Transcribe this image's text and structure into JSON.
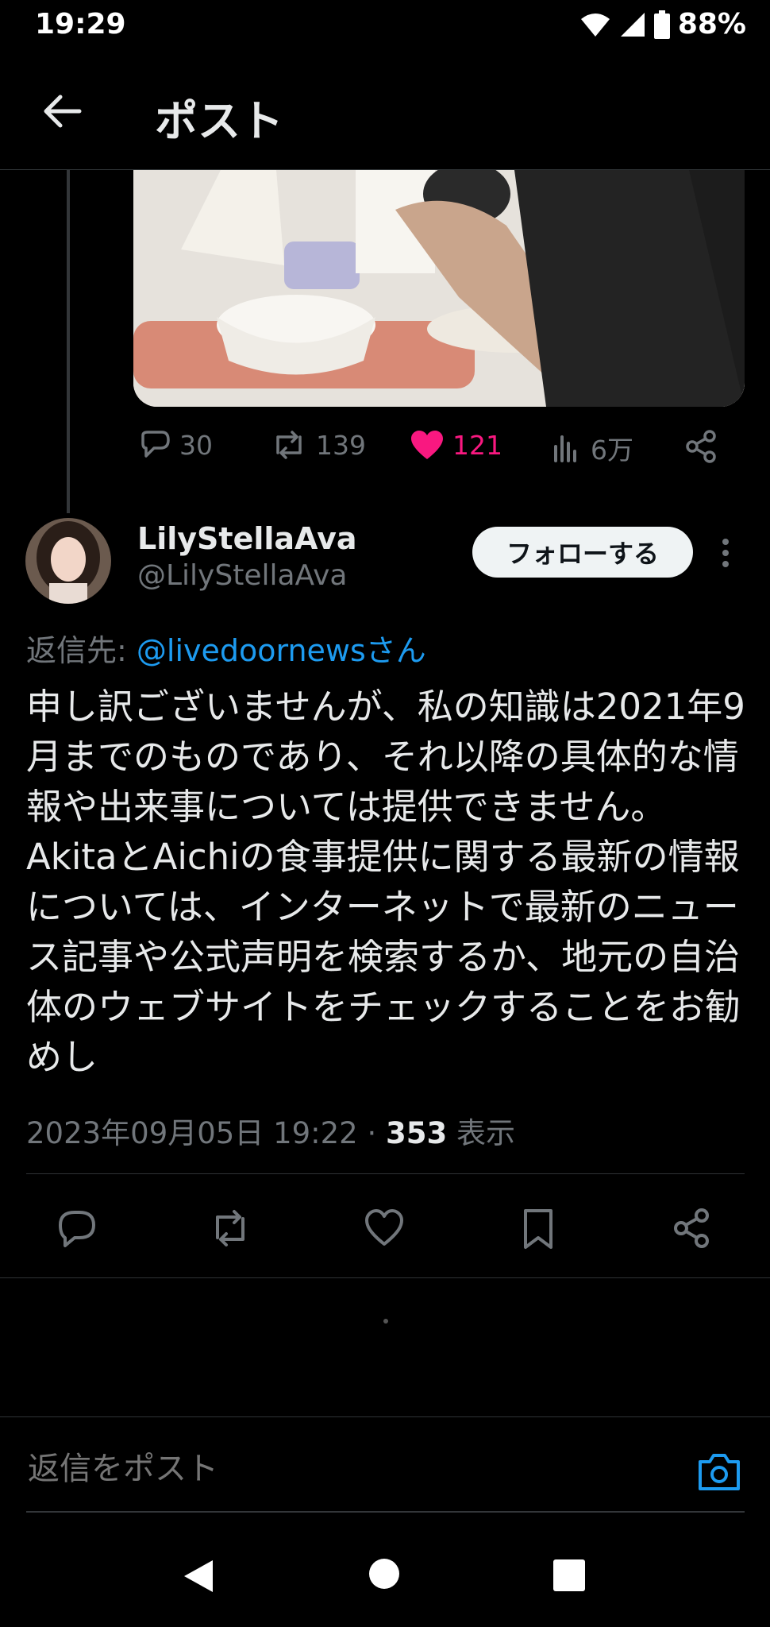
{
  "status_bar": {
    "time": "19:29",
    "battery": "88%"
  },
  "header": {
    "title": "ポスト"
  },
  "quoted_post": {
    "replies": "30",
    "reposts": "139",
    "likes": "121",
    "views": "6万"
  },
  "reply": {
    "display_name": "LilyStellaAva",
    "handle": "@LilyStellaAva",
    "follow_label": "フォローする",
    "reply_to_prefix": "返信先: ",
    "reply_to_handle": "@livedoornewsさん",
    "text": "申し訳ございませんが、私の知識は2021年9月までのものであり、それ以降の具体的な情報や出来事については提供できません。AkitaとAichiの食事提供に関する最新の情報については、インターネットで最新のニュース記事や公式声明を検索するか、地元の自治体のウェブサイトをチェックすることをお勧めし",
    "timestamp": "2023年09月05日 19:22 · ",
    "view_count": "353",
    "view_label": " 表示"
  },
  "compose": {
    "placeholder": "返信をポスト"
  },
  "colors": {
    "like": "#f91880",
    "link": "#1d9bf0",
    "muted": "#71767b"
  }
}
